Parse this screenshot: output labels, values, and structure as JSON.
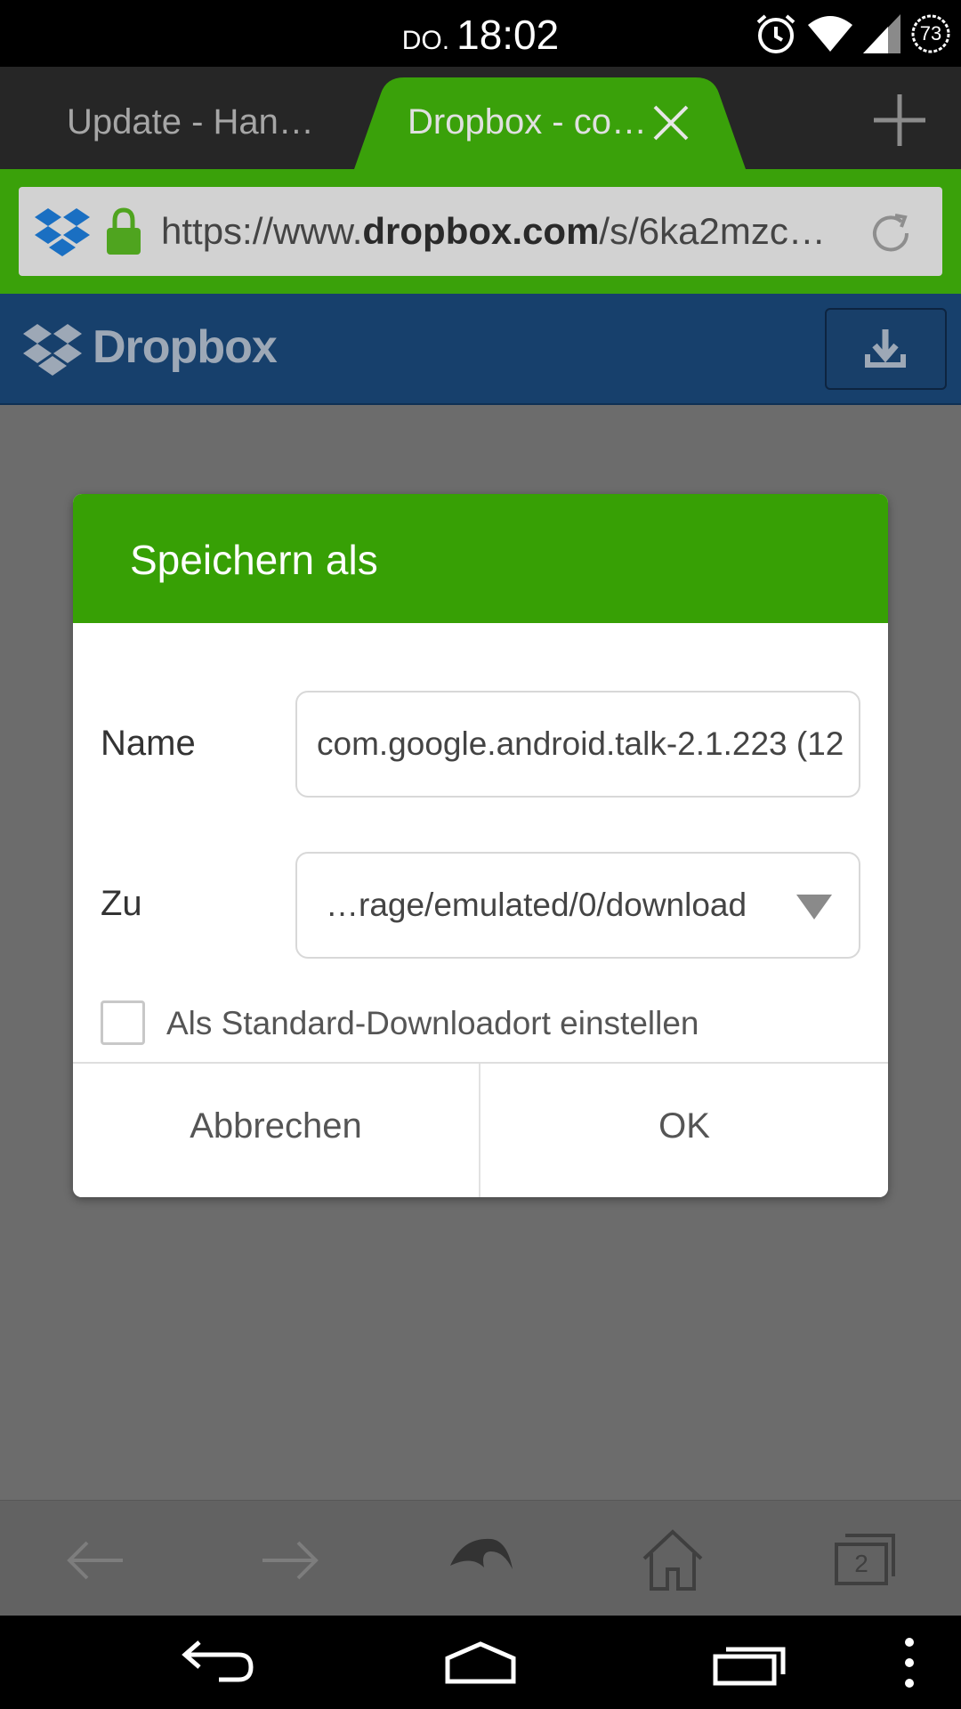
{
  "status_bar": {
    "day": "DO.",
    "time": "18:02",
    "battery_level": "73",
    "icons": [
      "alarm-icon",
      "wifi-icon",
      "signal-icon",
      "battery-icon"
    ]
  },
  "tabs": [
    {
      "label": "Update - Han…",
      "active": false
    },
    {
      "label": "Dropbox - co…",
      "active": true
    }
  ],
  "url_bar": {
    "url_prefix": "https://www.",
    "url_domain": "dropbox.com",
    "url_rest": "/s/6ka2mzc…"
  },
  "page": {
    "brand": "Dropbox"
  },
  "dialog": {
    "title": "Speichern als",
    "name_label": "Name",
    "name_value": "com.google.android.talk-2.1.223 (12",
    "to_label": "Zu",
    "to_value": "…rage/emulated/0/download",
    "default_checkbox_label": "Als Standard-Downloadort einstellen",
    "default_checked": false,
    "cancel_label": "Abbrechen",
    "ok_label": "OK"
  },
  "toolbar": {
    "tab_count": "2"
  },
  "colors": {
    "accent_green": "#37a005",
    "dropbox_blue": "#17406c"
  }
}
